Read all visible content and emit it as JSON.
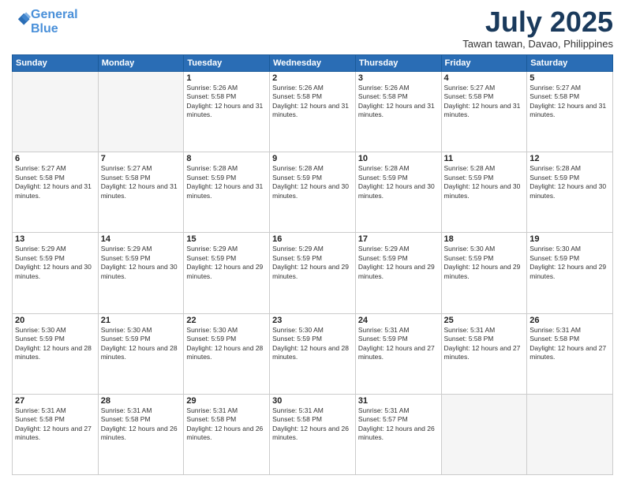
{
  "logo": {
    "line1": "General",
    "line2": "Blue"
  },
  "title": "July 2025",
  "subtitle": "Tawan tawan, Davao, Philippines",
  "days_header": [
    "Sunday",
    "Monday",
    "Tuesday",
    "Wednesday",
    "Thursday",
    "Friday",
    "Saturday"
  ],
  "weeks": [
    [
      {
        "num": "",
        "sunrise": "",
        "sunset": "",
        "daylight": ""
      },
      {
        "num": "",
        "sunrise": "",
        "sunset": "",
        "daylight": ""
      },
      {
        "num": "1",
        "sunrise": "Sunrise: 5:26 AM",
        "sunset": "Sunset: 5:58 PM",
        "daylight": "Daylight: 12 hours and 31 minutes."
      },
      {
        "num": "2",
        "sunrise": "Sunrise: 5:26 AM",
        "sunset": "Sunset: 5:58 PM",
        "daylight": "Daylight: 12 hours and 31 minutes."
      },
      {
        "num": "3",
        "sunrise": "Sunrise: 5:26 AM",
        "sunset": "Sunset: 5:58 PM",
        "daylight": "Daylight: 12 hours and 31 minutes."
      },
      {
        "num": "4",
        "sunrise": "Sunrise: 5:27 AM",
        "sunset": "Sunset: 5:58 PM",
        "daylight": "Daylight: 12 hours and 31 minutes."
      },
      {
        "num": "5",
        "sunrise": "Sunrise: 5:27 AM",
        "sunset": "Sunset: 5:58 PM",
        "daylight": "Daylight: 12 hours and 31 minutes."
      }
    ],
    [
      {
        "num": "6",
        "sunrise": "Sunrise: 5:27 AM",
        "sunset": "Sunset: 5:58 PM",
        "daylight": "Daylight: 12 hours and 31 minutes."
      },
      {
        "num": "7",
        "sunrise": "Sunrise: 5:27 AM",
        "sunset": "Sunset: 5:58 PM",
        "daylight": "Daylight: 12 hours and 31 minutes."
      },
      {
        "num": "8",
        "sunrise": "Sunrise: 5:28 AM",
        "sunset": "Sunset: 5:59 PM",
        "daylight": "Daylight: 12 hours and 31 minutes."
      },
      {
        "num": "9",
        "sunrise": "Sunrise: 5:28 AM",
        "sunset": "Sunset: 5:59 PM",
        "daylight": "Daylight: 12 hours and 30 minutes."
      },
      {
        "num": "10",
        "sunrise": "Sunrise: 5:28 AM",
        "sunset": "Sunset: 5:59 PM",
        "daylight": "Daylight: 12 hours and 30 minutes."
      },
      {
        "num": "11",
        "sunrise": "Sunrise: 5:28 AM",
        "sunset": "Sunset: 5:59 PM",
        "daylight": "Daylight: 12 hours and 30 minutes."
      },
      {
        "num": "12",
        "sunrise": "Sunrise: 5:28 AM",
        "sunset": "Sunset: 5:59 PM",
        "daylight": "Daylight: 12 hours and 30 minutes."
      }
    ],
    [
      {
        "num": "13",
        "sunrise": "Sunrise: 5:29 AM",
        "sunset": "Sunset: 5:59 PM",
        "daylight": "Daylight: 12 hours and 30 minutes."
      },
      {
        "num": "14",
        "sunrise": "Sunrise: 5:29 AM",
        "sunset": "Sunset: 5:59 PM",
        "daylight": "Daylight: 12 hours and 30 minutes."
      },
      {
        "num": "15",
        "sunrise": "Sunrise: 5:29 AM",
        "sunset": "Sunset: 5:59 PM",
        "daylight": "Daylight: 12 hours and 29 minutes."
      },
      {
        "num": "16",
        "sunrise": "Sunrise: 5:29 AM",
        "sunset": "Sunset: 5:59 PM",
        "daylight": "Daylight: 12 hours and 29 minutes."
      },
      {
        "num": "17",
        "sunrise": "Sunrise: 5:29 AM",
        "sunset": "Sunset: 5:59 PM",
        "daylight": "Daylight: 12 hours and 29 minutes."
      },
      {
        "num": "18",
        "sunrise": "Sunrise: 5:30 AM",
        "sunset": "Sunset: 5:59 PM",
        "daylight": "Daylight: 12 hours and 29 minutes."
      },
      {
        "num": "19",
        "sunrise": "Sunrise: 5:30 AM",
        "sunset": "Sunset: 5:59 PM",
        "daylight": "Daylight: 12 hours and 29 minutes."
      }
    ],
    [
      {
        "num": "20",
        "sunrise": "Sunrise: 5:30 AM",
        "sunset": "Sunset: 5:59 PM",
        "daylight": "Daylight: 12 hours and 28 minutes."
      },
      {
        "num": "21",
        "sunrise": "Sunrise: 5:30 AM",
        "sunset": "Sunset: 5:59 PM",
        "daylight": "Daylight: 12 hours and 28 minutes."
      },
      {
        "num": "22",
        "sunrise": "Sunrise: 5:30 AM",
        "sunset": "Sunset: 5:59 PM",
        "daylight": "Daylight: 12 hours and 28 minutes."
      },
      {
        "num": "23",
        "sunrise": "Sunrise: 5:30 AM",
        "sunset": "Sunset: 5:59 PM",
        "daylight": "Daylight: 12 hours and 28 minutes."
      },
      {
        "num": "24",
        "sunrise": "Sunrise: 5:31 AM",
        "sunset": "Sunset: 5:59 PM",
        "daylight": "Daylight: 12 hours and 27 minutes."
      },
      {
        "num": "25",
        "sunrise": "Sunrise: 5:31 AM",
        "sunset": "Sunset: 5:58 PM",
        "daylight": "Daylight: 12 hours and 27 minutes."
      },
      {
        "num": "26",
        "sunrise": "Sunrise: 5:31 AM",
        "sunset": "Sunset: 5:58 PM",
        "daylight": "Daylight: 12 hours and 27 minutes."
      }
    ],
    [
      {
        "num": "27",
        "sunrise": "Sunrise: 5:31 AM",
        "sunset": "Sunset: 5:58 PM",
        "daylight": "Daylight: 12 hours and 27 minutes."
      },
      {
        "num": "28",
        "sunrise": "Sunrise: 5:31 AM",
        "sunset": "Sunset: 5:58 PM",
        "daylight": "Daylight: 12 hours and 26 minutes."
      },
      {
        "num": "29",
        "sunrise": "Sunrise: 5:31 AM",
        "sunset": "Sunset: 5:58 PM",
        "daylight": "Daylight: 12 hours and 26 minutes."
      },
      {
        "num": "30",
        "sunrise": "Sunrise: 5:31 AM",
        "sunset": "Sunset: 5:58 PM",
        "daylight": "Daylight: 12 hours and 26 minutes."
      },
      {
        "num": "31",
        "sunrise": "Sunrise: 5:31 AM",
        "sunset": "Sunset: 5:57 PM",
        "daylight": "Daylight: 12 hours and 26 minutes."
      },
      {
        "num": "",
        "sunrise": "",
        "sunset": "",
        "daylight": ""
      },
      {
        "num": "",
        "sunrise": "",
        "sunset": "",
        "daylight": ""
      }
    ]
  ]
}
